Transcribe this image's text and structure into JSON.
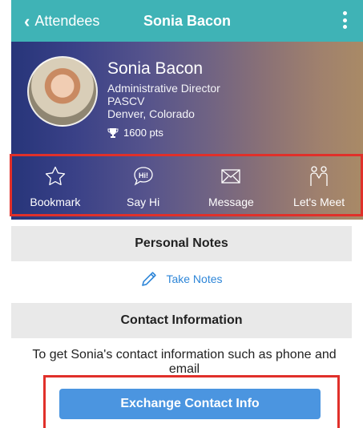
{
  "navbar": {
    "back_label": "Attendees",
    "title": "Sonia Bacon"
  },
  "profile": {
    "name": "Sonia Bacon",
    "title": "Administrative Director",
    "organization": "PASCV",
    "location": "Denver, Colorado",
    "points": "1600 pts"
  },
  "actions": [
    {
      "label": "Bookmark",
      "icon": "star-icon"
    },
    {
      "label": "Say Hi",
      "icon": "hi-bubble-icon"
    },
    {
      "label": "Message",
      "icon": "envelope-icon"
    },
    {
      "label": "Let's Meet",
      "icon": "people-icon"
    }
  ],
  "personal_notes": {
    "header": "Personal Notes",
    "take_notes_label": "Take Notes"
  },
  "contact": {
    "header": "Contact Information",
    "description": "To get Sonia's contact information such as phone and email",
    "button_label": "Exchange Contact Info"
  },
  "colors": {
    "navbar": "#3fb3b6",
    "accent": "#2e86d8",
    "button": "#4b95e0",
    "highlight": "#e0302a"
  }
}
